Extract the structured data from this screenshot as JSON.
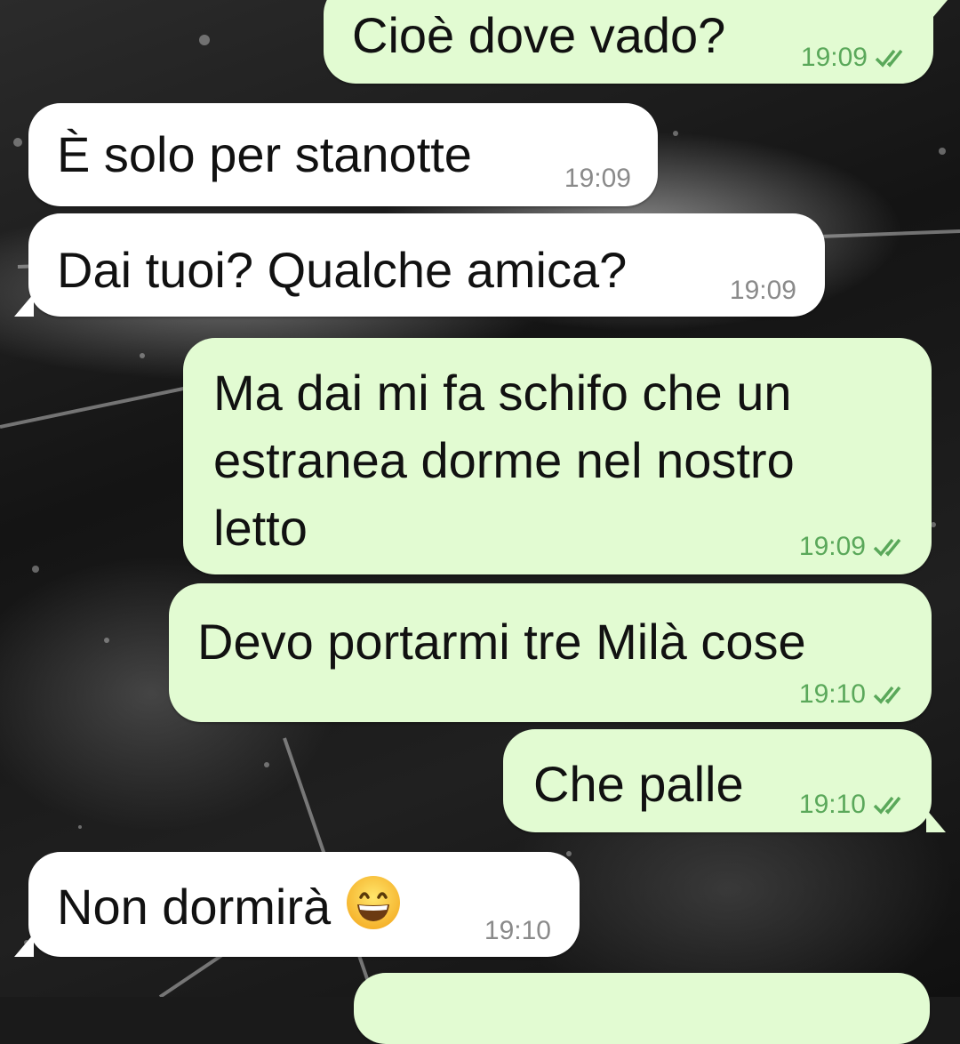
{
  "messages": [
    {
      "id": 1,
      "direction": "out",
      "text": "Cioè dove vado?",
      "time": "19:09",
      "status": "read"
    },
    {
      "id": 2,
      "direction": "in",
      "text": "È solo per stanotte",
      "time": "19:09"
    },
    {
      "id": 3,
      "direction": "in",
      "text": "Dai tuoi? Qualche amica?",
      "time": "19:09"
    },
    {
      "id": 4,
      "direction": "out",
      "text": "Ma dai mi fa schifo che un\nestranea dorme nel nostro\nletto",
      "time": "19:09",
      "status": "read"
    },
    {
      "id": 5,
      "direction": "out",
      "text": "Devo portarmi tre Milà cose",
      "time": "19:10",
      "status": "read"
    },
    {
      "id": 6,
      "direction": "out",
      "text": "Che palle",
      "time": "19:10",
      "status": "read"
    },
    {
      "id": 7,
      "direction": "in",
      "text": "Non dormirà",
      "emoji": "grinning-face-emoji",
      "time": "19:10"
    }
  ],
  "colors": {
    "outgoing_bubble": "#e2fbd2",
    "incoming_bubble": "#ffffff",
    "read_ticks": "#5aa85a",
    "incoming_time": "#8a8a8a"
  },
  "icons": {
    "read_receipt": "double-check-icon"
  }
}
